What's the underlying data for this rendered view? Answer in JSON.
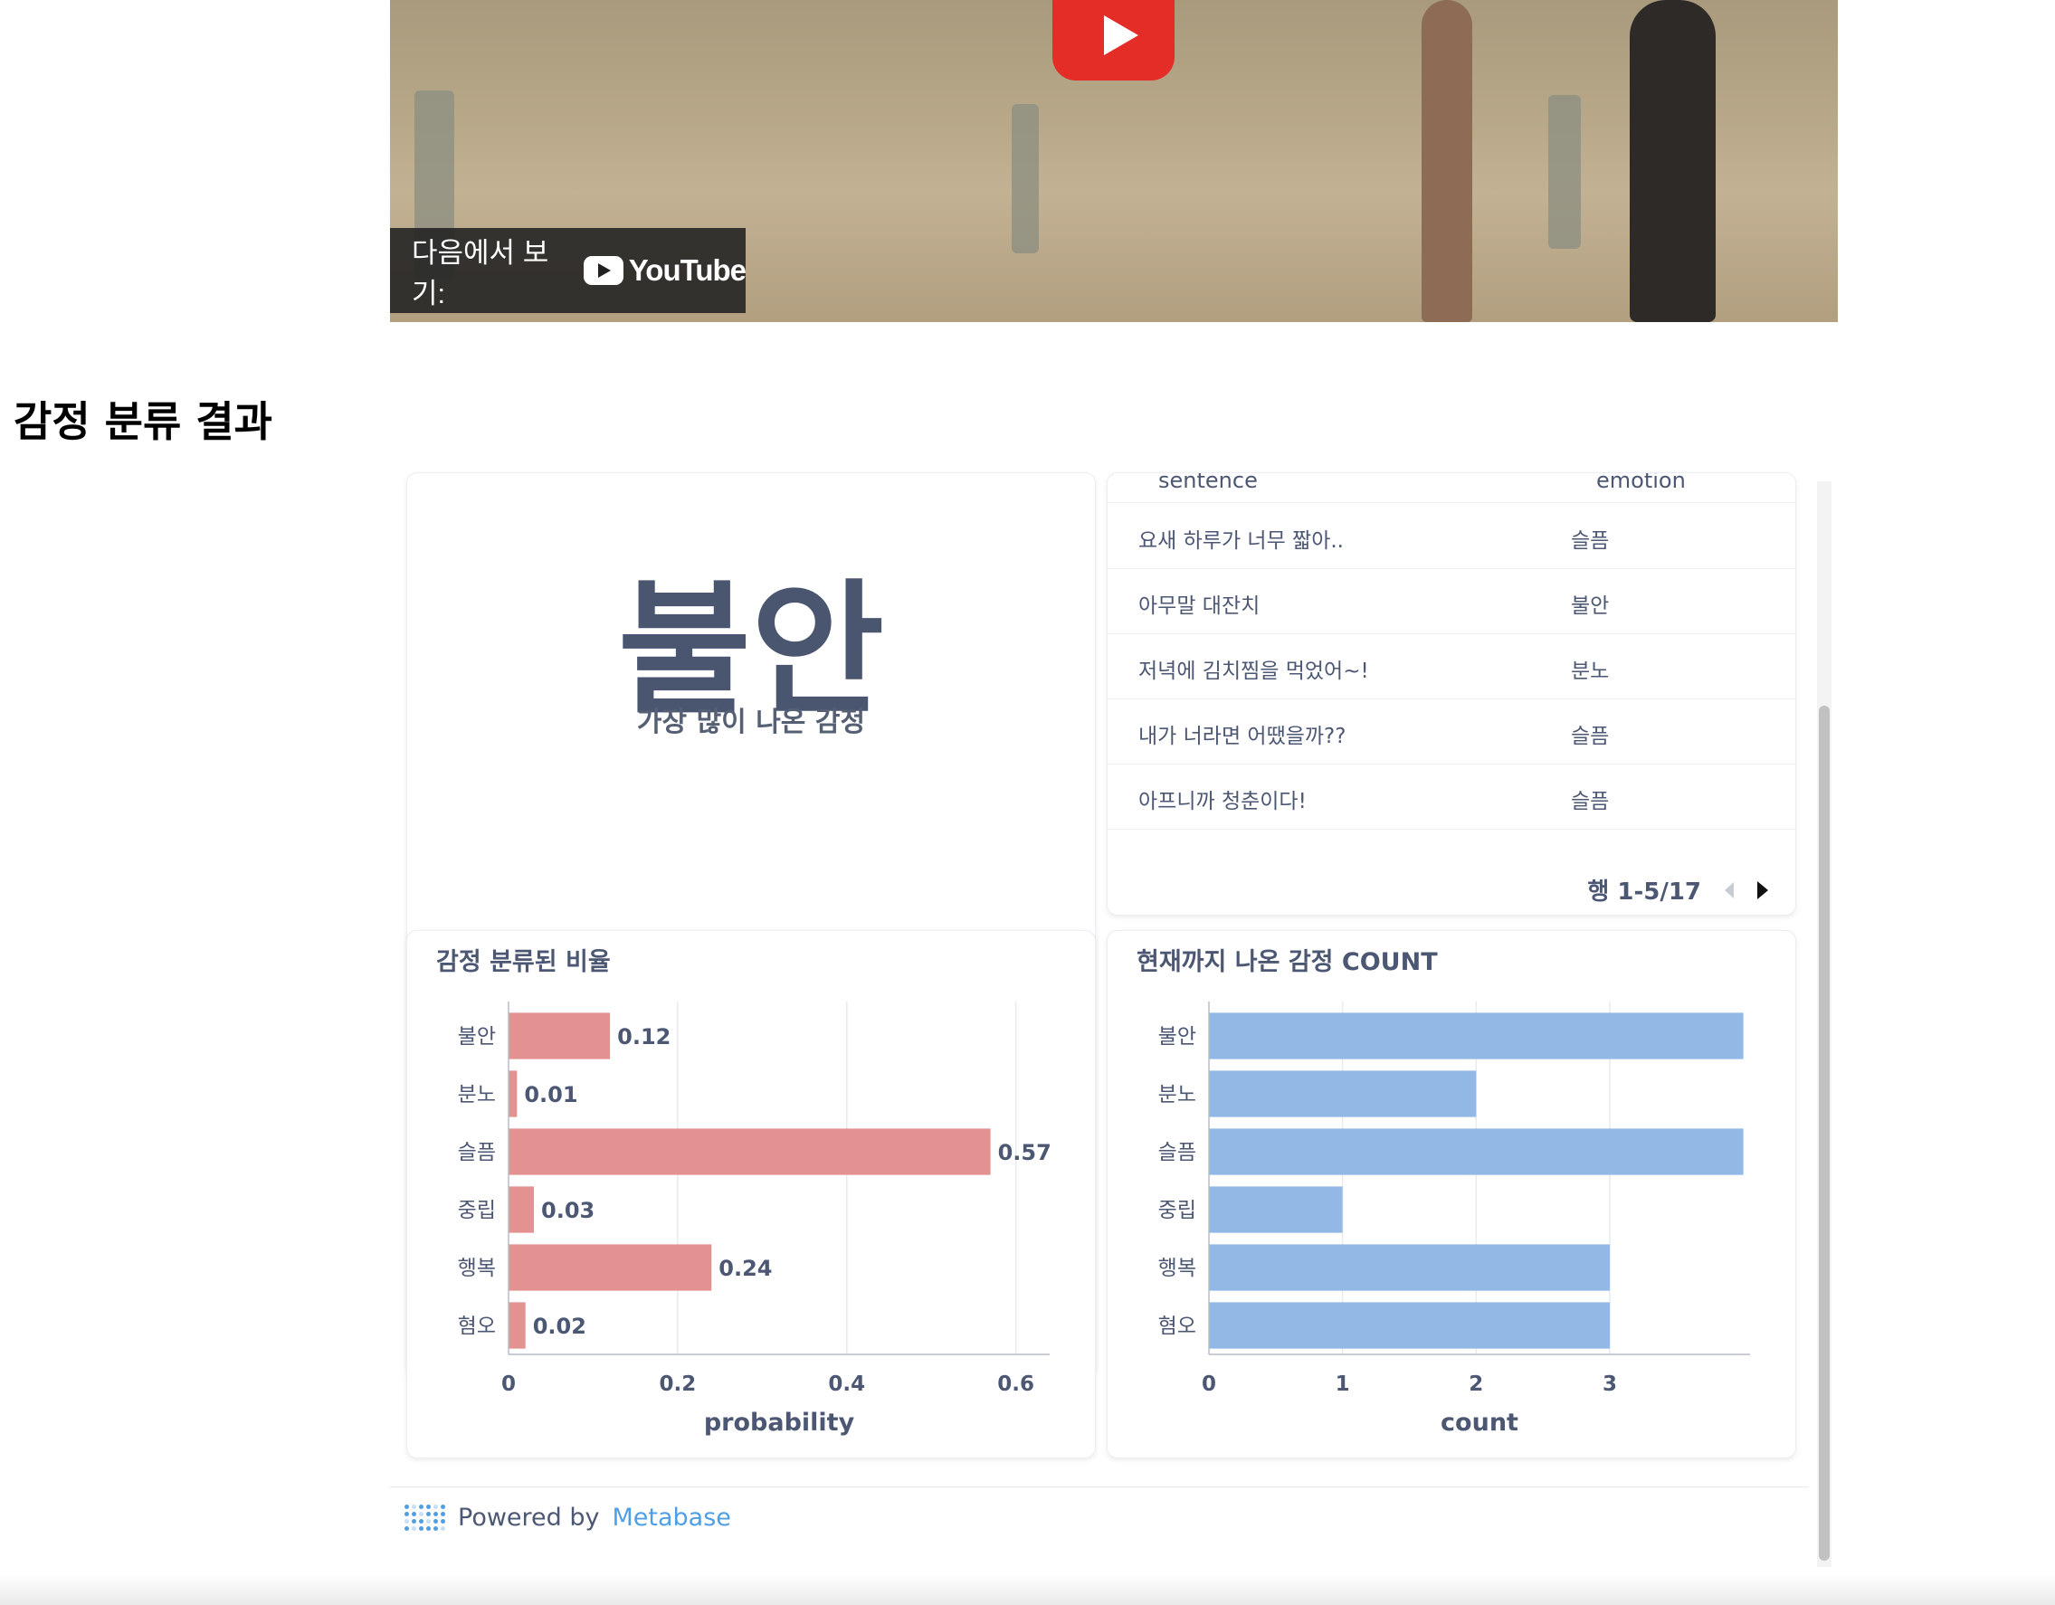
{
  "video": {
    "watch_on": "다음에서 보기:",
    "youtube": "YouTube"
  },
  "section_title": "감정 분류 결과",
  "summary": {
    "emotion": "불안",
    "label": "가장 많이 나온 감정"
  },
  "table": {
    "columns": [
      "sentence",
      "emotion"
    ],
    "rows": [
      {
        "sentence": "요새 하루가 너무 짧아..",
        "emotion": "슬픔"
      },
      {
        "sentence": "아무말 대잔치",
        "emotion": "불안"
      },
      {
        "sentence": "저녁에 김치찜을 먹었어~!",
        "emotion": "분노"
      },
      {
        "sentence": "내가 너라면 어땠을까??",
        "emotion": "슬픔"
      },
      {
        "sentence": "아프니까 청춘이다!",
        "emotion": "슬픔"
      }
    ],
    "pagination": "행 1-5/17"
  },
  "chart_data": [
    {
      "type": "bar",
      "title": "감정 분류된 비율",
      "orientation": "horizontal",
      "categories": [
        "불안",
        "분노",
        "슬픔",
        "중립",
        "행복",
        "혐오"
      ],
      "values": [
        0.12,
        0.01,
        0.57,
        0.03,
        0.24,
        0.02
      ],
      "xlabel": "probability",
      "xlim": [
        0,
        0.64
      ],
      "xticks": [
        "0",
        "0.2",
        "0.4",
        "0.6"
      ],
      "xtick_values": [
        0,
        0.2,
        0.4,
        0.6
      ],
      "data_labels": true,
      "color": "#e39191",
      "grid": true
    },
    {
      "type": "bar",
      "title": "현재까지 나온 감정 COUNT",
      "orientation": "horizontal",
      "categories": [
        "불안",
        "분노",
        "슬픔",
        "중립",
        "행복",
        "혐오"
      ],
      "values": [
        4,
        2,
        4,
        1,
        3,
        3
      ],
      "xlabel": "count",
      "xlim": [
        0,
        4.05
      ],
      "xticks": [
        "0",
        "1",
        "2",
        "3"
      ],
      "xtick_values": [
        0,
        1,
        2,
        3
      ],
      "data_labels": false,
      "color": "#92b9e6",
      "grid": true
    }
  ],
  "footer": {
    "powered_by": "Powered by",
    "brand": "Metabase"
  }
}
